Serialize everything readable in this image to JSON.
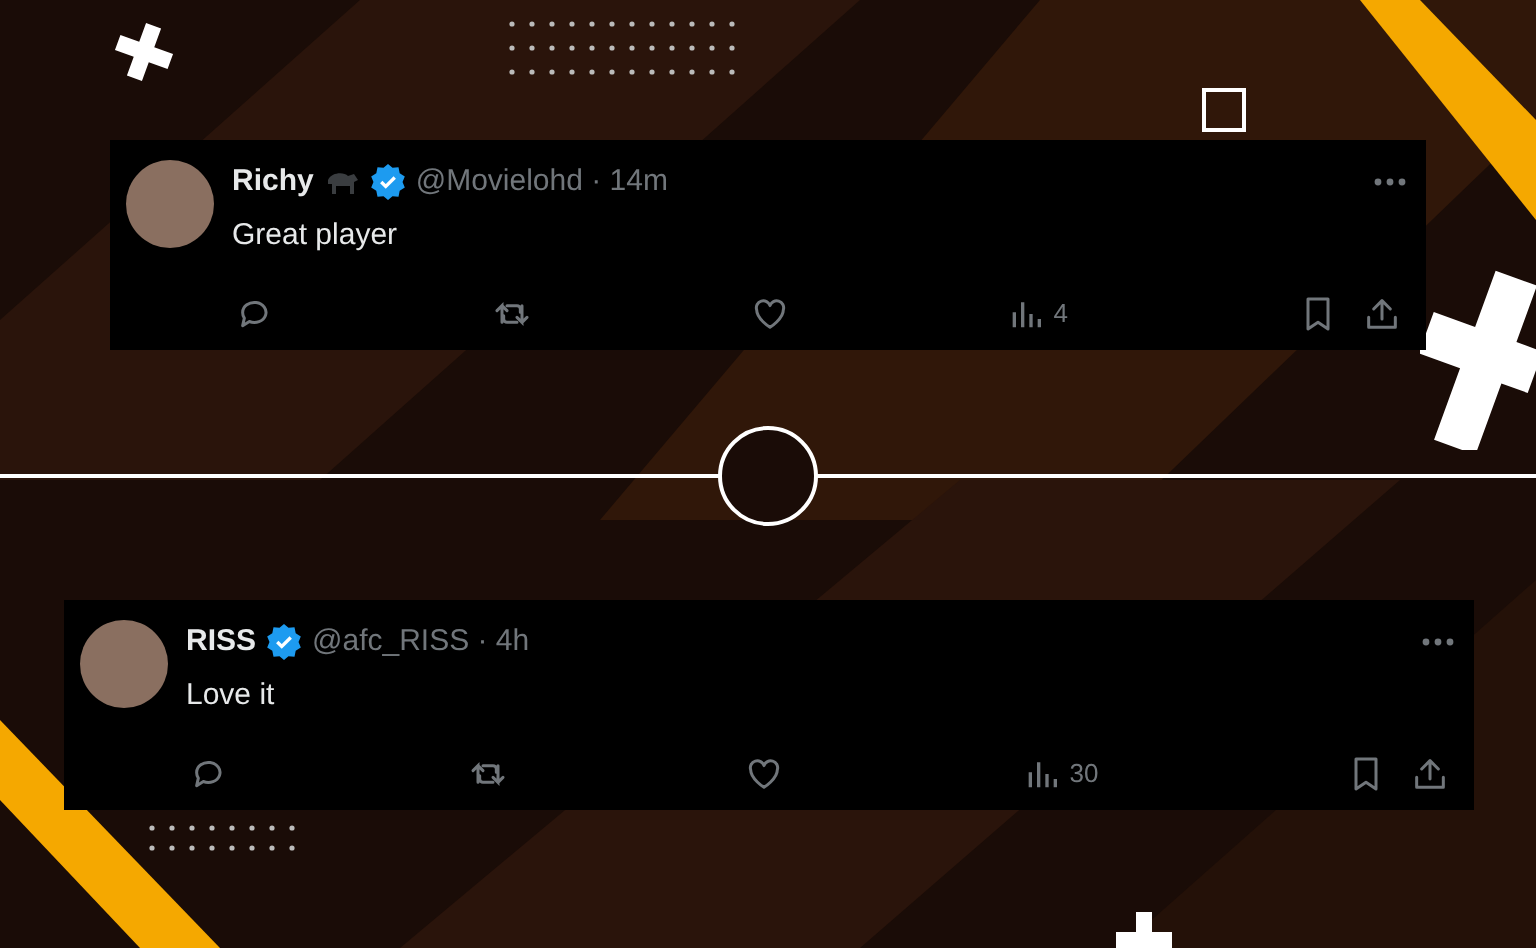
{
  "tweets": [
    {
      "name": "Richy",
      "has_emoji": true,
      "verified": true,
      "meta": "@Movielohd · 14m",
      "text": "Great player",
      "views": "4"
    },
    {
      "name": "RISS",
      "has_emoji": false,
      "verified": true,
      "meta": "@afc_RISS · 4h",
      "text": "Love it",
      "views": "30"
    }
  ]
}
